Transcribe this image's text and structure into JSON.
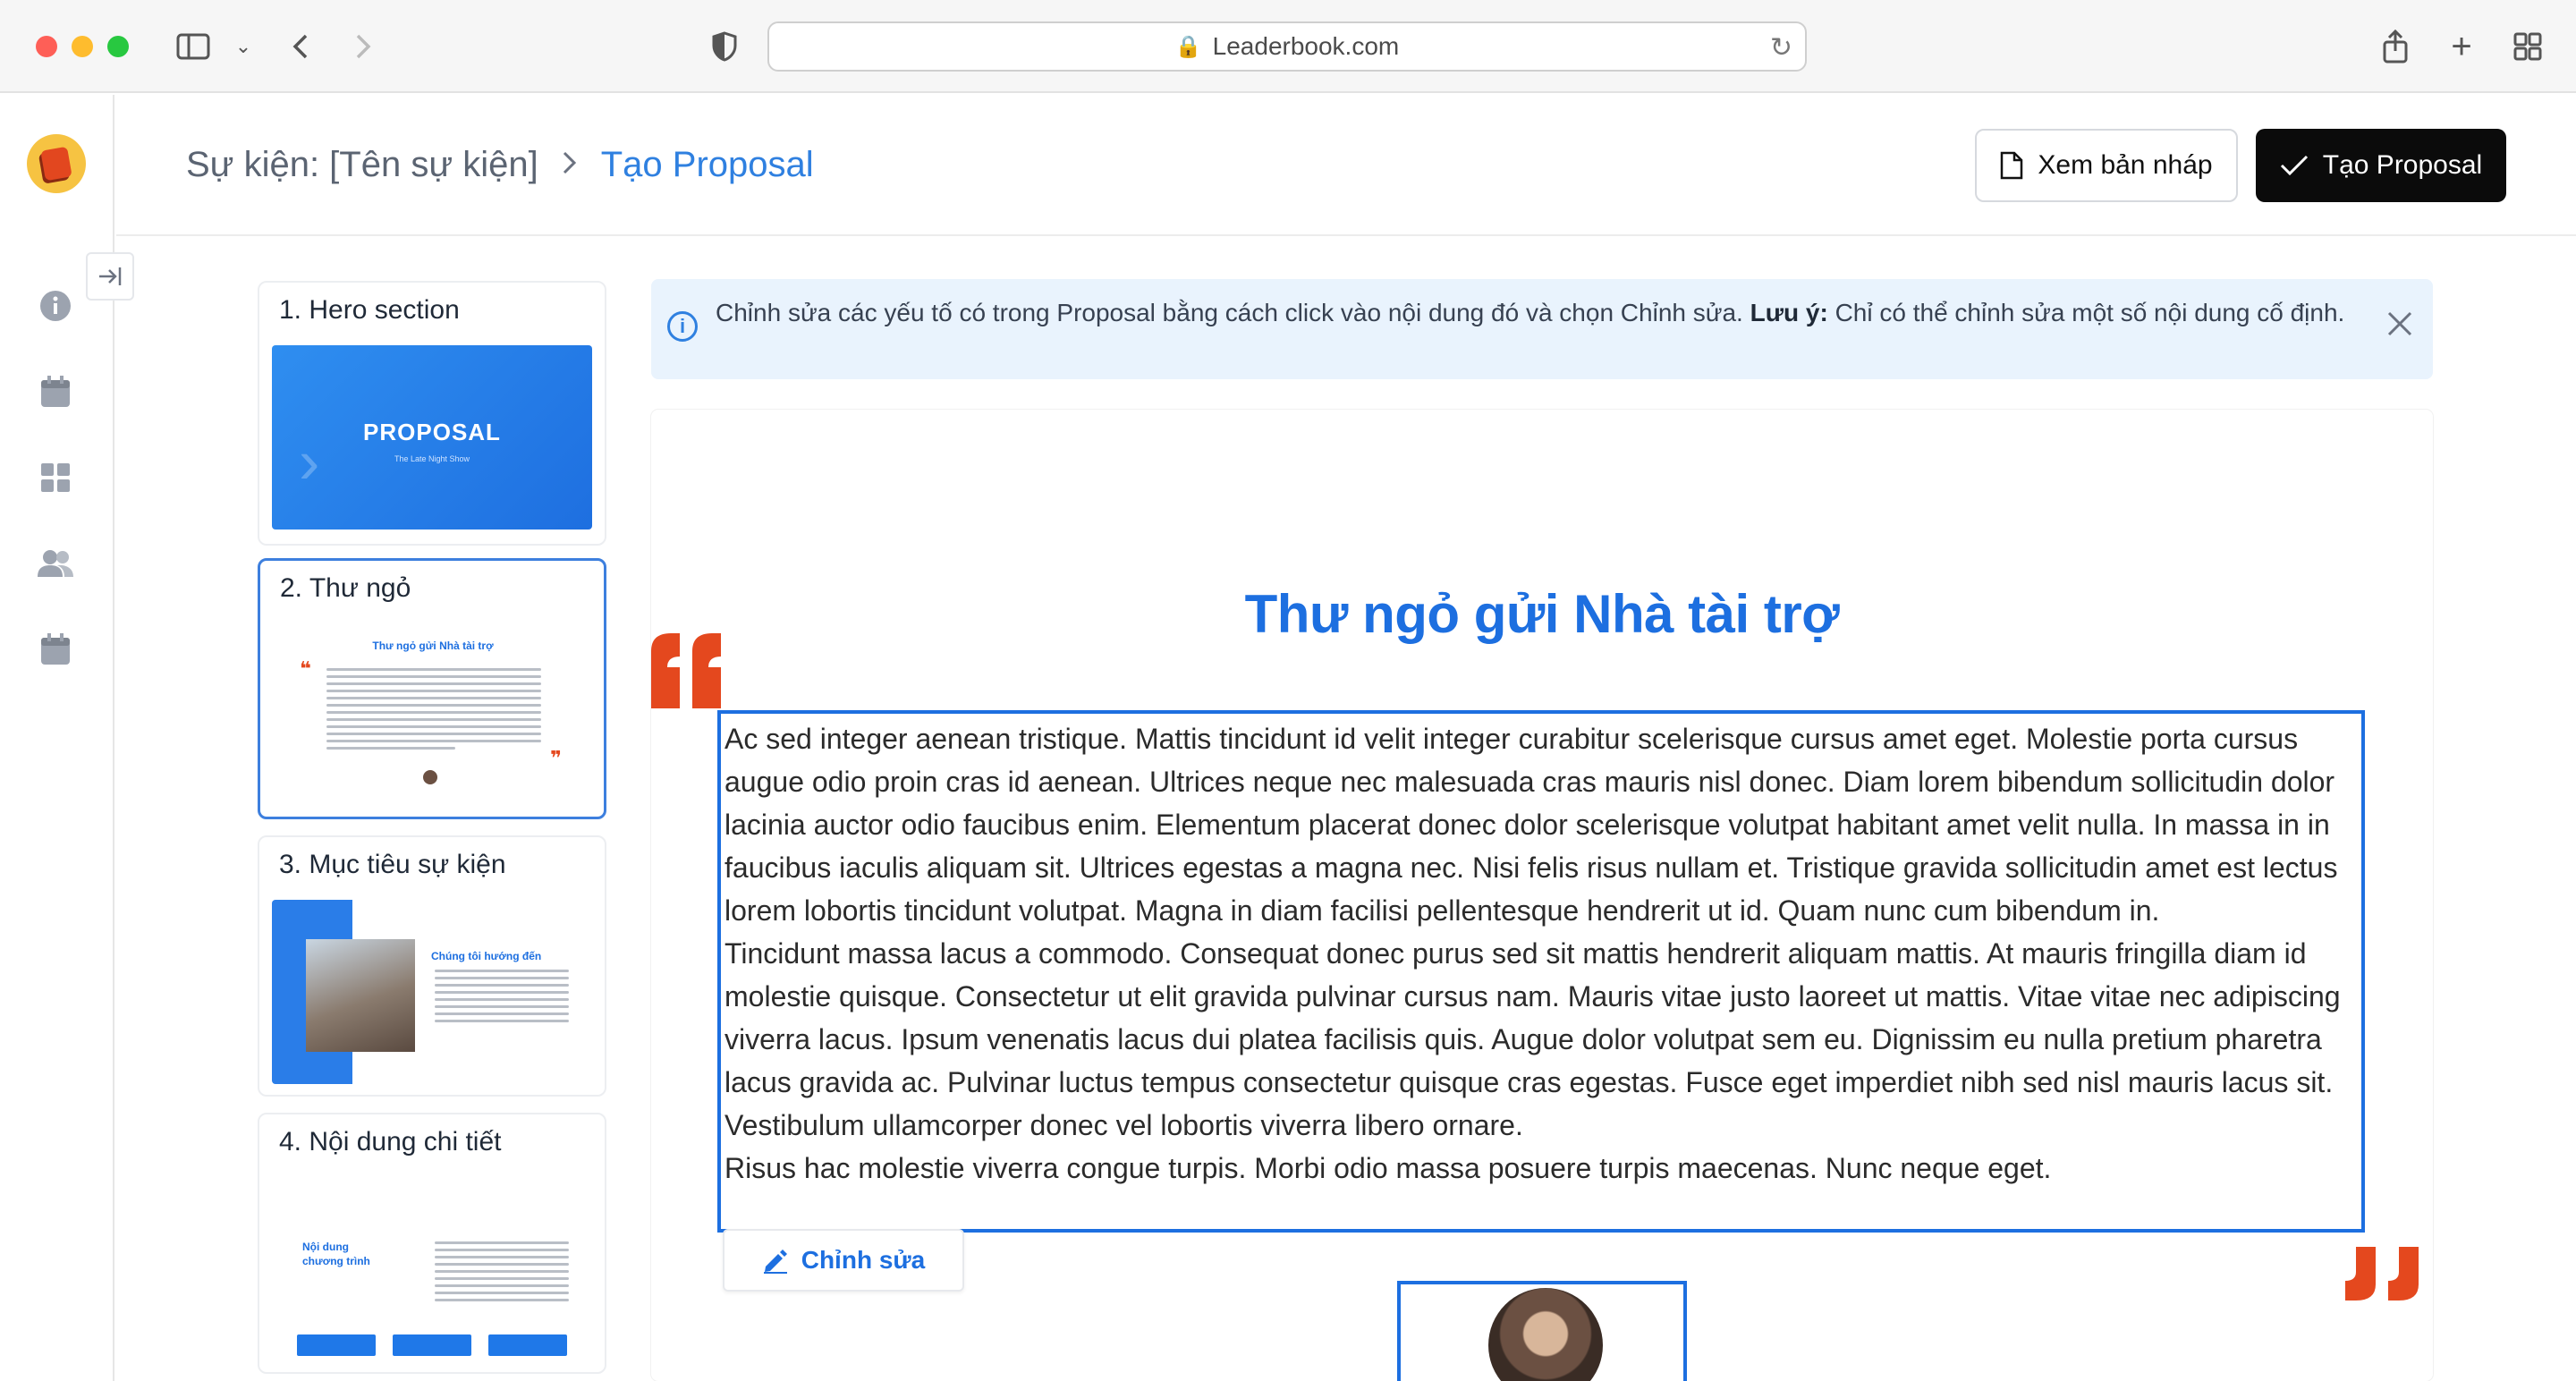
{
  "browser": {
    "url": "Leaderbook.com"
  },
  "header": {
    "breadcrumb_parent": "Sự kiện: [Tên sự kiện]",
    "breadcrumb_current": "Tạo Proposal",
    "draft_button": "Xem bản nháp",
    "create_button": "Tạo Proposal"
  },
  "sections": [
    {
      "title": "1. Hero section",
      "thumb_title": "PROPOSAL",
      "thumb_sub": "The Late Night Show"
    },
    {
      "title": "2. Thư ngỏ",
      "thumb_title": "Thư ngỏ gửi Nhà tài trợ"
    },
    {
      "title": "3. Mục tiêu sự kiện",
      "thumb_title": "Chúng tôi hướng đến"
    },
    {
      "title": "4. Nội dung chi tiết",
      "thumb_title": "Nội dung chương trình"
    }
  ],
  "banner": {
    "text": "Chỉnh sửa các yếu tố có trong Proposal bằng cách click vào nội dung đó và chọn Chỉnh sửa.",
    "note_label": "Lưu ý:",
    "note_text": "Chỉ có thể chỉnh sửa một số nội dung cố định."
  },
  "letter": {
    "title": "Thư ngỏ gửi Nhà tài trợ",
    "paragraphs": [
      "Ac sed integer aenean tristique. Mattis tincidunt id velit integer curabitur scelerisque cursus amet eget. Molestie porta cursus augue odio proin cras id aenean. Ultrices neque nec malesuada cras mauris nisl donec. Diam lorem bibendum sollicitudin dolor lacinia auctor odio faucibus enim. Elementum placerat donec dolor scelerisque volutpat habitant amet velit nulla. In massa in in faucibus iaculis aliquam sit. Ultrices egestas a magna nec. Nisi felis risus nullam et. Tristique gravida sollicitudin amet est lectus lorem lobortis tincidunt volutpat. Magna in diam facilisi pellentesque hendrerit ut id. Quam nunc cum bibendum in.",
      "Tincidunt massa lacus a commodo. Consequat donec purus sed sit mattis hendrerit aliquam mattis. At mauris fringilla diam id molestie quisque. Consectetur ut elit gravida pulvinar cursus nam. Mauris vitae justo laoreet ut mattis. Vitae vitae nec adipiscing viverra lacus. Ipsum venenatis lacus dui platea facilisis quis. Augue dolor volutpat sem eu. Dignissim eu nulla pretium pharetra lacus gravida ac. Pulvinar luctus tempus consectetur quisque cras egestas. Fusce eget imperdiet nibh sed nisl mauris lacus sit. Vestibulum ullamcorper donec vel lobortis viverra libero ornare.",
      "Risus hac molestie viverra congue turpis. Morbi odio massa posuere turpis maecenas. Nunc neque eget."
    ],
    "edit_button": "Chỉnh sửa"
  },
  "colors": {
    "accent": "#1d6fe0",
    "quote": "#e4481e"
  }
}
